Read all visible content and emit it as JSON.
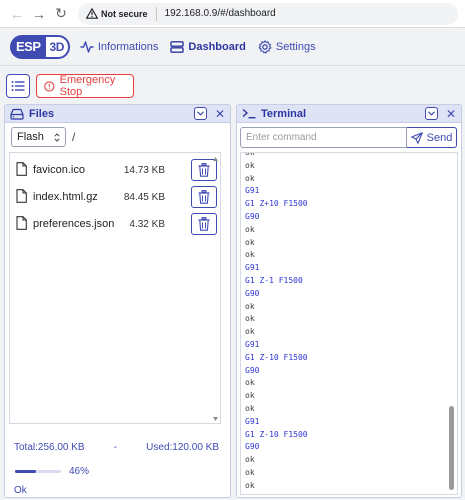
{
  "browser": {
    "security_label": "Not secure",
    "url": "192.168.0.9/#/dashboard"
  },
  "header": {
    "logo_left": "ESP",
    "logo_right": "3D",
    "nav": [
      {
        "label": "Informations",
        "icon": "activity-icon",
        "active": false
      },
      {
        "label": "Dashboard",
        "icon": "dashboard-icon",
        "active": true
      },
      {
        "label": "Settings",
        "icon": "gear-icon",
        "active": false
      }
    ]
  },
  "toolbar": {
    "menu_icon": "list-icon",
    "estop_label": "Emergency Stop"
  },
  "files": {
    "title": "Files",
    "filesystem": "Flash",
    "path": "/",
    "items": [
      {
        "name": "favicon.ico",
        "size": "14.73 KB"
      },
      {
        "name": "index.html.gz",
        "size": "84.45 KB"
      },
      {
        "name": "preferences.json",
        "size": "4.32 KB"
      }
    ],
    "total": "Total:256.00 KB",
    "dash": "-",
    "used": "Used:120.00 KB",
    "progress_percent": 46,
    "progress_label": "46%",
    "status": "Ok"
  },
  "terminal": {
    "title": "Terminal",
    "input_placeholder": "Enter command",
    "send_label": "Send",
    "lines": [
      {
        "text": "ok",
        "kind": "resp"
      },
      {
        "text": "ok",
        "kind": "resp"
      },
      {
        "text": "ok",
        "kind": "resp"
      },
      {
        "text": "G91",
        "kind": "cmd"
      },
      {
        "text": "G1 Z+10 F1500",
        "kind": "cmd"
      },
      {
        "text": "G90",
        "kind": "cmd"
      },
      {
        "text": "ok",
        "kind": "resp"
      },
      {
        "text": "ok",
        "kind": "resp"
      },
      {
        "text": "ok",
        "kind": "resp"
      },
      {
        "text": "G91",
        "kind": "cmd"
      },
      {
        "text": "G1 Z-1 F1500",
        "kind": "cmd"
      },
      {
        "text": "G90",
        "kind": "cmd"
      },
      {
        "text": "ok",
        "kind": "resp"
      },
      {
        "text": "ok",
        "kind": "resp"
      },
      {
        "text": "ok",
        "kind": "resp"
      },
      {
        "text": "G91",
        "kind": "cmd"
      },
      {
        "text": "G1 Z-10 F1500",
        "kind": "cmd"
      },
      {
        "text": "G90",
        "kind": "cmd"
      },
      {
        "text": "ok",
        "kind": "resp"
      },
      {
        "text": "ok",
        "kind": "resp"
      },
      {
        "text": "ok",
        "kind": "resp"
      },
      {
        "text": "G91",
        "kind": "cmd"
      },
      {
        "text": "G1 Z-10 F1500",
        "kind": "cmd"
      },
      {
        "text": "G90",
        "kind": "cmd"
      },
      {
        "text": "ok",
        "kind": "resp"
      },
      {
        "text": "ok",
        "kind": "resp"
      },
      {
        "text": "ok",
        "kind": "resp"
      }
    ]
  },
  "colors": {
    "accent": "#3f4ab3",
    "danger": "#e53e3e",
    "command_text": "#2c36d0"
  }
}
